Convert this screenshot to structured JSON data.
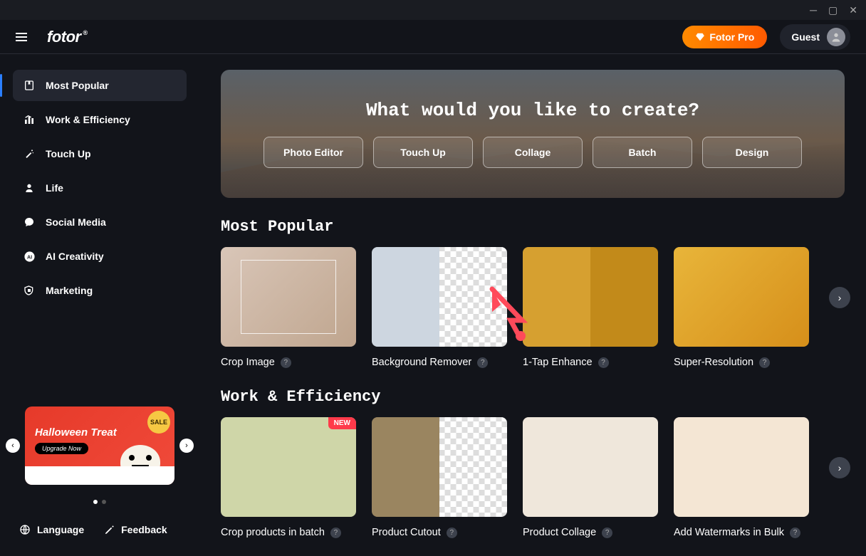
{
  "window_controls": {
    "min": "─",
    "max": "▢",
    "close": "✕"
  },
  "logo": "fotor",
  "header": {
    "pro_label": "Fotor Pro",
    "guest_label": "Guest"
  },
  "sidebar": {
    "items": [
      {
        "label": "Most Popular",
        "icon": "bookmark"
      },
      {
        "label": "Work & Efficiency",
        "icon": "bars"
      },
      {
        "label": "Touch Up",
        "icon": "wand"
      },
      {
        "label": "Life",
        "icon": "person"
      },
      {
        "label": "Social Media",
        "icon": "chat"
      },
      {
        "label": "AI Creativity",
        "icon": "ai"
      },
      {
        "label": "Marketing",
        "icon": "tag"
      }
    ]
  },
  "promo": {
    "badge": "SALE",
    "title": "Halloween Treat",
    "cta": "Upgrade Now"
  },
  "footer": {
    "language": "Language",
    "feedback": "Feedback"
  },
  "hero": {
    "title": "What would you like to create?",
    "buttons": [
      "Photo Editor",
      "Touch Up",
      "Collage",
      "Batch",
      "Design"
    ]
  },
  "sections": [
    {
      "title": "Most Popular",
      "cards": [
        {
          "label": "Crop Image",
          "thumb": "t-crop"
        },
        {
          "label": "Background Remover",
          "thumb": "t-bg"
        },
        {
          "label": "1-Tap Enhance",
          "thumb": "t-enh"
        },
        {
          "label": "Super-Resolution",
          "thumb": "t-super"
        }
      ]
    },
    {
      "title": "Work & Efficiency",
      "cards": [
        {
          "label": "Crop products in batch",
          "thumb": "t-batch",
          "badge": "NEW"
        },
        {
          "label": "Product Cutout",
          "thumb": "t-cut"
        },
        {
          "label": "Product Collage",
          "thumb": "t-coll"
        },
        {
          "label": "Add Watermarks in Bulk",
          "thumb": "t-wat"
        }
      ]
    }
  ]
}
